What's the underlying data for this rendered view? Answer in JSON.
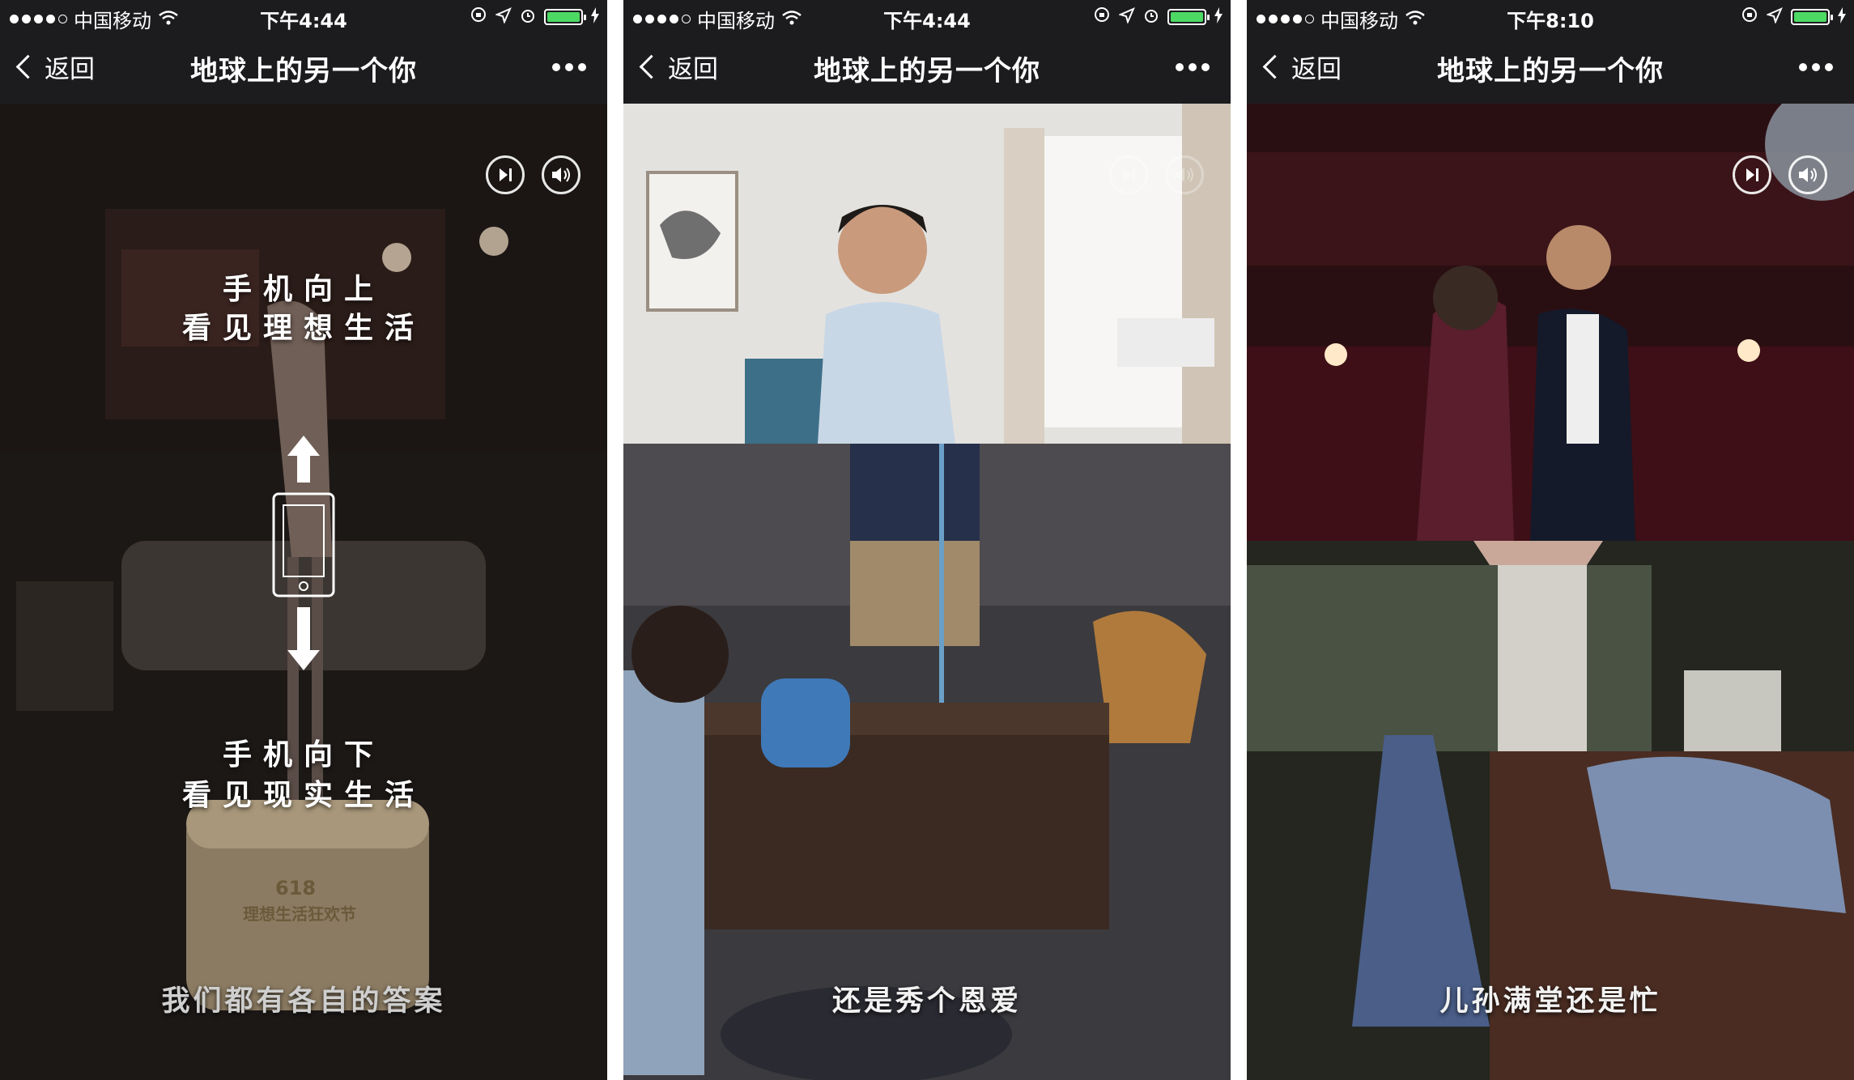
{
  "colors": {
    "bar_bg": "#1c1c1f",
    "battery_green": "#4cd964",
    "text": "#ffffff"
  },
  "screens": [
    {
      "status": {
        "carrier": "中国移动",
        "time": "下午4:44"
      },
      "nav": {
        "back_label": "返回",
        "title": "地球上的另一个你"
      },
      "overlay": {
        "up_line1": "手机向上",
        "up_line2": "看见理想生活",
        "down_line1": "手机向下",
        "down_line2": "看见现实生活"
      },
      "box_text": {
        "number": "618",
        "slogan": "理想生活狂欢节"
      },
      "caption": "我们都有各自的答案"
    },
    {
      "status": {
        "carrier": "中国移动",
        "time": "下午4:44"
      },
      "nav": {
        "back_label": "返回",
        "title": "地球上的另一个你"
      },
      "caption": "还是秀个恩爱"
    },
    {
      "status": {
        "carrier": "中国移动",
        "time": "下午8:10"
      },
      "nav": {
        "back_label": "返回",
        "title": "地球上的另一个你"
      },
      "caption": "儿孙满堂还是忙"
    }
  ]
}
